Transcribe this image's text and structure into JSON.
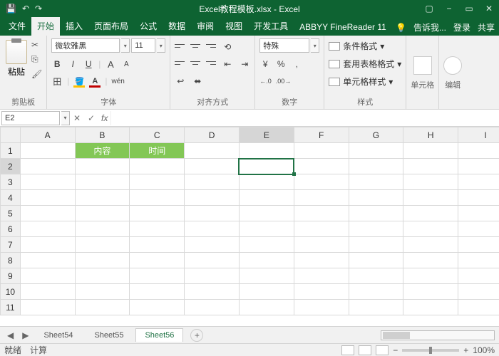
{
  "title": "Excel教程模板.xlsx - Excel",
  "tabs": {
    "file": "文件",
    "home": "开始",
    "insert": "插入",
    "layout": "页面布局",
    "formula": "公式",
    "data": "数据",
    "review": "审阅",
    "view": "视图",
    "dev": "开发工具",
    "abbyy": "ABBYY FineReader 11"
  },
  "tellme": "告诉我...",
  "signin": "登录",
  "share": "共享",
  "ribbon": {
    "clipboard": {
      "label": "剪贴板",
      "paste": "粘贴"
    },
    "font": {
      "label": "字体",
      "name": "微软雅黑",
      "size": "11",
      "bold": "B",
      "italic": "I",
      "underline": "U",
      "grow": "A",
      "shrink": "A",
      "border": "田",
      "fill": "A",
      "color": "A",
      "ruby": "wén"
    },
    "align": {
      "label": "对齐方式"
    },
    "number": {
      "label": "数字",
      "format": "特殊",
      "currency": "¥",
      "percent": "%",
      "comma": ",",
      "inc": "←.0",
      "dec": ".00→"
    },
    "styles": {
      "label": "样式",
      "cond": "条件格式",
      "table": "套用表格格式",
      "cell": "单元格样式"
    },
    "cells": {
      "label": "单元格"
    },
    "edit": {
      "label": "编辑"
    }
  },
  "namebox": "E2",
  "fx": "fx",
  "cols": [
    "A",
    "B",
    "C",
    "D",
    "E",
    "F",
    "G",
    "H",
    "I"
  ],
  "rows": [
    "1",
    "2",
    "3",
    "4",
    "5",
    "6",
    "7",
    "8",
    "9",
    "10",
    "11"
  ],
  "cells": {
    "B1": "内容",
    "C1": "时间"
  },
  "sheets": {
    "nav_l": "◀",
    "nav_r": "▶",
    "s1": "Sheet54",
    "s2": "Sheet55",
    "s3": "Sheet56",
    "new": "+"
  },
  "status": {
    "ready": "就绪",
    "calc": "计算",
    "zoom": "100%",
    "minus": "−",
    "plus": "+"
  },
  "chart_data": {
    "type": "table",
    "title": "",
    "columns": [
      "内容",
      "时间"
    ],
    "rows": []
  }
}
